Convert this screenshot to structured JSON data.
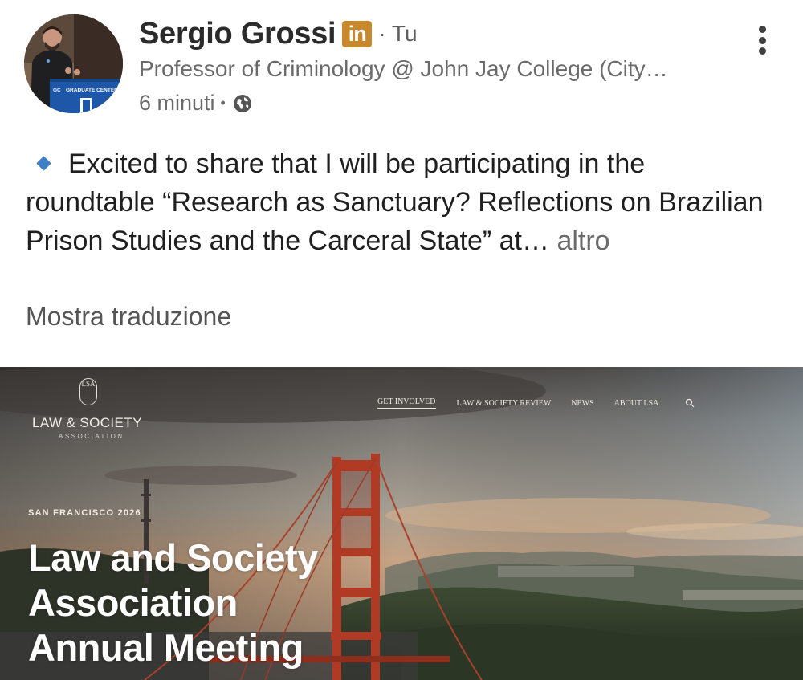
{
  "author": {
    "name": "Sergio Grossi",
    "badge": "in",
    "you_tag": "· Tu",
    "headline": "Professor of Criminology @ John Jay College (City…",
    "time": "6 minuti",
    "time_separator": "•",
    "avatar_banner": "GRADUATE CENTER",
    "avatar_mark": "GC"
  },
  "post": {
    "text": "Excited to share that I will be participating in the roundtable “Research as Sanctuary? Reflections on Brazilian Prison Studies and the Carceral State” at…",
    "see_more": "altro",
    "translate": "Mostra traduzione"
  },
  "preview": {
    "logo_mark": "LSA",
    "logo_name": "LAW & SOCIETY",
    "logo_sub": "ASSOCIATION",
    "nav": [
      "GET INVOLVED",
      "LAW & SOCIETY REVIEW",
      "NEWS",
      "ABOUT LSA"
    ],
    "kicker": "SAN FRANCISCO 2026",
    "title_lines": [
      "Law and Society",
      "Association",
      "Annual Meeting"
    ]
  },
  "colors": {
    "badge_bg": "#c8892c",
    "bullet": "#3f7fc8",
    "bridge": "#b13a24"
  },
  "icons": {
    "globe": "globe-icon",
    "more": "more-vertical-icon",
    "bullet": "blue-diamond-icon",
    "search": "search-icon"
  }
}
